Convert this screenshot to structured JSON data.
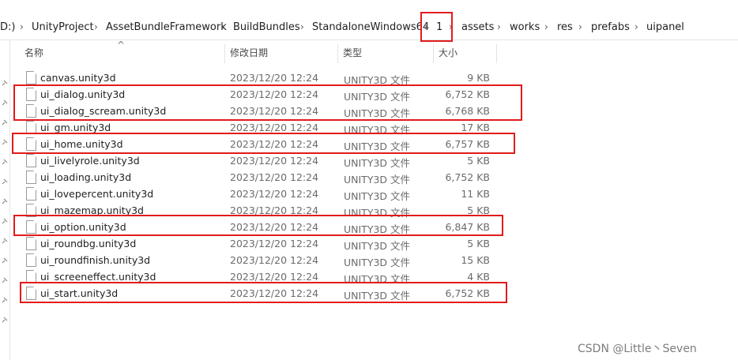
{
  "breadcrumb": [
    "D:)",
    "UnityProject",
    "AssetBundleFramework",
    "BuildBundles",
    "StandaloneWindows64",
    "1",
    "assets",
    "works",
    "res",
    "prefabs",
    "uipanel"
  ],
  "columns": {
    "name": "名称",
    "date": "修改日期",
    "type": "类型",
    "size": "大小"
  },
  "files": [
    {
      "name": "canvas.unity3d",
      "date": "2023/12/20 12:24",
      "type": "UNITY3D 文件",
      "size": "9 KB"
    },
    {
      "name": "ui_dialog.unity3d",
      "date": "2023/12/20 12:24",
      "type": "UNITY3D 文件",
      "size": "6,752 KB"
    },
    {
      "name": "ui_dialog_scream.unity3d",
      "date": "2023/12/20 12:24",
      "type": "UNITY3D 文件",
      "size": "6,768 KB"
    },
    {
      "name": "ui_gm.unity3d",
      "date": "2023/12/20 12:24",
      "type": "UNITY3D 文件",
      "size": "17 KB"
    },
    {
      "name": "ui_home.unity3d",
      "date": "2023/12/20 12:24",
      "type": "UNITY3D 文件",
      "size": "6,757 KB"
    },
    {
      "name": "ui_livelyrole.unity3d",
      "date": "2023/12/20 12:24",
      "type": "UNITY3D 文件",
      "size": "5 KB"
    },
    {
      "name": "ui_loading.unity3d",
      "date": "2023/12/20 12:24",
      "type": "UNITY3D 文件",
      "size": "6,752 KB"
    },
    {
      "name": "ui_lovepercent.unity3d",
      "date": "2023/12/20 12:24",
      "type": "UNITY3D 文件",
      "size": "11 KB"
    },
    {
      "name": "ui_mazemap.unity3d",
      "date": "2023/12/20 12:24",
      "type": "UNITY3D 文件",
      "size": "5 KB"
    },
    {
      "name": "ui_option.unity3d",
      "date": "2023/12/20 12:24",
      "type": "UNITY3D 文件",
      "size": "6,847 KB"
    },
    {
      "name": "ui_roundbg.unity3d",
      "date": "2023/12/20 12:24",
      "type": "UNITY3D 文件",
      "size": "5 KB"
    },
    {
      "name": "ui_roundfinish.unity3d",
      "date": "2023/12/20 12:24",
      "type": "UNITY3D 文件",
      "size": "15 KB"
    },
    {
      "name": "ui_screeneffect.unity3d",
      "date": "2023/12/20 12:24",
      "type": "UNITY3D 文件",
      "size": "4 KB"
    },
    {
      "name": "ui_start.unity3d",
      "date": "2023/12/20 12:24",
      "type": "UNITY3D 文件",
      "size": "6,752 KB"
    }
  ],
  "annotation_color": "#e21b1b",
  "watermark": "CSDN @Little丶Seven"
}
